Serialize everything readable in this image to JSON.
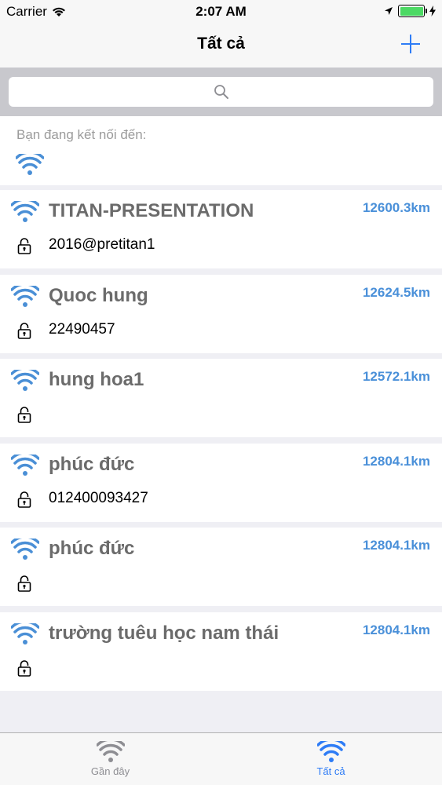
{
  "status_bar": {
    "carrier": "Carrier",
    "time": "2:07 AM"
  },
  "nav": {
    "title": "Tất cả",
    "add_label": "+"
  },
  "search": {
    "placeholder": ""
  },
  "connected": {
    "label": "Bạn đang kết nối đến:"
  },
  "networks": [
    {
      "ssid": "TITAN-PRESENTATION",
      "distance": "12600.3km",
      "password": "2016@pretitan1"
    },
    {
      "ssid": "Quoc hung",
      "distance": "12624.5km",
      "password": "22490457"
    },
    {
      "ssid": "hung hoa1",
      "distance": "12572.1km",
      "password": ""
    },
    {
      "ssid": "phúc đức",
      "distance": "12804.1km",
      "password": "012400093427"
    },
    {
      "ssid": "phúc đức",
      "distance": "12804.1km",
      "password": ""
    },
    {
      "ssid": "trường tuêu học nam thái",
      "distance": "12804.1km",
      "password": ""
    }
  ],
  "tabs": [
    {
      "label": "Gần đây",
      "active": false
    },
    {
      "label": "Tất cả",
      "active": true
    }
  ],
  "colors": {
    "accent": "#2e7cf6",
    "wifi": "#4a8fd6",
    "distance": "#4a90d9",
    "tab_inactive": "#8e8e93"
  }
}
